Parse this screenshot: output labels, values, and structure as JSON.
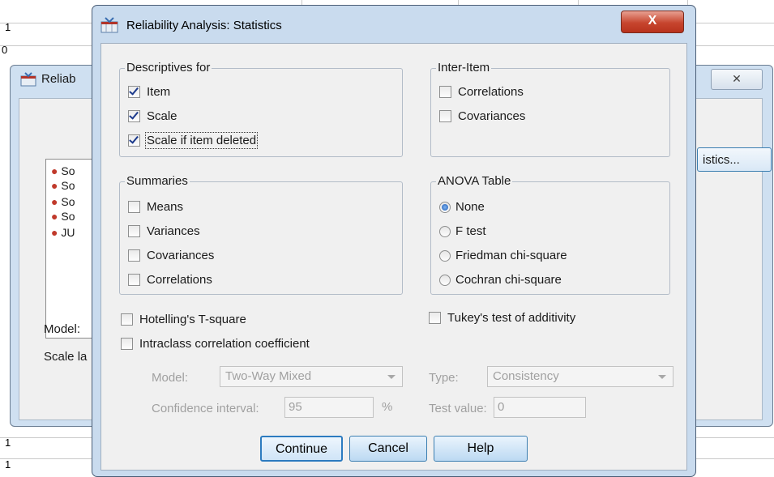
{
  "background": {
    "row_numbers": [
      "1",
      "0",
      "1",
      "1"
    ],
    "dialog_title": "Reliab",
    "close_glyph": "✕",
    "list_items": [
      "So",
      "So",
      "So",
      "So",
      "JU"
    ],
    "statistics_button": "istics...",
    "model_label": "Model:",
    "scale_label": "Scale la"
  },
  "dialog": {
    "title": "Reliability Analysis: Statistics",
    "close_glyph": "X",
    "descriptives": {
      "title": "Descriptives for",
      "items": [
        {
          "label": "Item",
          "checked": true
        },
        {
          "label": "Scale",
          "checked": true
        },
        {
          "label": "Scale if item deleted",
          "checked": true
        }
      ]
    },
    "inter_item": {
      "title": "Inter-Item",
      "items": [
        {
          "label": "Correlations",
          "checked": false
        },
        {
          "label": "Covariances",
          "checked": false
        }
      ]
    },
    "summaries": {
      "title": "Summaries",
      "items": [
        {
          "label": "Means",
          "checked": false
        },
        {
          "label": "Variances",
          "checked": false
        },
        {
          "label": "Covariances",
          "checked": false
        },
        {
          "label": "Correlations",
          "checked": false
        }
      ]
    },
    "anova": {
      "title": "ANOVA Table",
      "items": [
        {
          "label": "None",
          "selected": true
        },
        {
          "label": "F test",
          "selected": false
        },
        {
          "label": "Friedman chi-square",
          "selected": false
        },
        {
          "label": "Cochran chi-square",
          "selected": false
        }
      ]
    },
    "hotelling": "Hotelling's T-square",
    "tukey": "Tukey's test of additivity",
    "intraclass": "Intraclass correlation coefficient",
    "model_label": "Model:",
    "model_value": "Two-Way Mixed",
    "type_label": "Type:",
    "type_value": "Consistency",
    "ci_label": "Confidence interval:",
    "ci_value": "95",
    "ci_unit": "%",
    "test_value_label": "Test value:",
    "test_value": "0",
    "buttons": {
      "continue": "Continue",
      "cancel": "Cancel",
      "help": "Help"
    }
  }
}
